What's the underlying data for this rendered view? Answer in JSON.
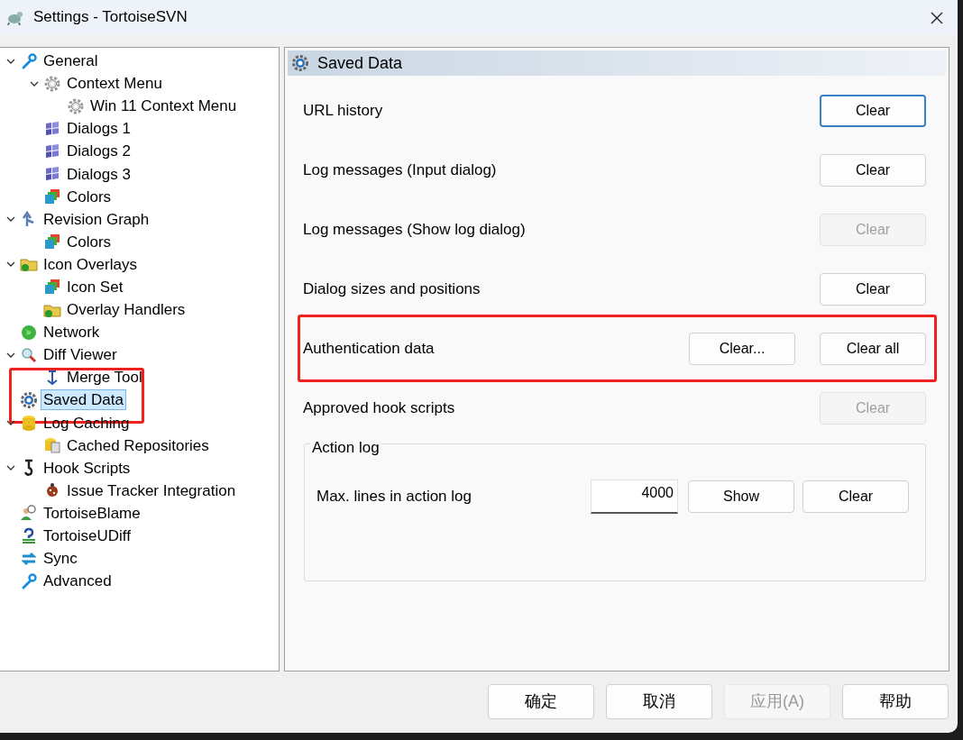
{
  "window": {
    "title": "Settings - TortoiseSVN"
  },
  "tree": [
    {
      "label": "General",
      "expanded": true,
      "selected": false,
      "highlighted": false,
      "children": [
        {
          "label": "Context Menu",
          "expanded": true,
          "selected": false,
          "highlighted": false,
          "children": [
            {
              "label": "Win 11 Context Menu",
              "selected": false,
              "highlighted": false
            }
          ]
        },
        {
          "label": "Dialogs 1",
          "selected": false,
          "highlighted": false
        },
        {
          "label": "Dialogs 2",
          "selected": false,
          "highlighted": false
        },
        {
          "label": "Dialogs 3",
          "selected": false,
          "highlighted": false
        },
        {
          "label": "Colors",
          "selected": false,
          "highlighted": false
        }
      ]
    },
    {
      "label": "Revision Graph",
      "expanded": true,
      "selected": false,
      "highlighted": false,
      "children": [
        {
          "label": "Colors",
          "selected": false,
          "highlighted": false
        }
      ]
    },
    {
      "label": "Icon Overlays",
      "expanded": true,
      "selected": false,
      "highlighted": false,
      "children": [
        {
          "label": "Icon Set",
          "selected": false,
          "highlighted": false
        },
        {
          "label": "Overlay Handlers",
          "selected": false,
          "highlighted": false
        }
      ]
    },
    {
      "label": "Network",
      "selected": false,
      "highlighted": false
    },
    {
      "label": "Diff Viewer",
      "expanded": true,
      "selected": false,
      "highlighted": false,
      "children": [
        {
          "label": "Merge Tool",
          "selected": false,
          "highlighted": false
        }
      ]
    },
    {
      "label": "Saved Data",
      "selected": true,
      "highlighted": true
    },
    {
      "label": "Log Caching",
      "expanded": true,
      "selected": false,
      "highlighted": false,
      "children": [
        {
          "label": "Cached Repositories",
          "selected": false,
          "highlighted": false
        }
      ]
    },
    {
      "label": "Hook Scripts",
      "expanded": true,
      "selected": false,
      "highlighted": false,
      "children": [
        {
          "label": "Issue Tracker Integration",
          "selected": false,
          "highlighted": false
        }
      ]
    },
    {
      "label": "TortoiseBlame",
      "selected": false,
      "highlighted": false
    },
    {
      "label": "TortoiseUDiff",
      "selected": false,
      "highlighted": false
    },
    {
      "label": "Sync",
      "selected": false,
      "highlighted": false
    },
    {
      "label": "Advanced",
      "selected": false,
      "highlighted": false
    }
  ],
  "page": {
    "title": "Saved Data",
    "rows": [
      {
        "label": "URL history",
        "highlighted": false,
        "buttons": [
          {
            "label": "Clear",
            "disabled": false,
            "focused": true
          }
        ]
      },
      {
        "label": "Log messages (Input dialog)",
        "highlighted": false,
        "buttons": [
          {
            "label": "Clear",
            "disabled": false,
            "focused": false
          }
        ]
      },
      {
        "label": "Log messages (Show log dialog)",
        "highlighted": false,
        "buttons": [
          {
            "label": "Clear",
            "disabled": true,
            "focused": false
          }
        ]
      },
      {
        "label": "Dialog sizes and positions",
        "highlighted": false,
        "buttons": [
          {
            "label": "Clear",
            "disabled": false,
            "focused": false
          }
        ]
      },
      {
        "label": "Authentication data",
        "highlighted": true,
        "buttons": [
          {
            "label": "Clear...",
            "disabled": false,
            "focused": false
          },
          {
            "label": "Clear all",
            "disabled": false,
            "focused": false
          }
        ]
      },
      {
        "label": "Approved hook scripts",
        "highlighted": false,
        "buttons": [
          {
            "label": "Clear",
            "disabled": true,
            "focused": false
          }
        ]
      }
    ],
    "action_log": {
      "title": "Action log",
      "label": "Max. lines in action log",
      "value": "4000",
      "buttons": [
        {
          "label": "Show",
          "disabled": false
        },
        {
          "label": "Clear",
          "disabled": false
        }
      ]
    }
  },
  "footer": [
    {
      "label": "确定",
      "disabled": false
    },
    {
      "label": "取消",
      "disabled": false
    },
    {
      "label": "应用(A)",
      "disabled": true
    },
    {
      "label": "帮助",
      "disabled": false
    }
  ]
}
